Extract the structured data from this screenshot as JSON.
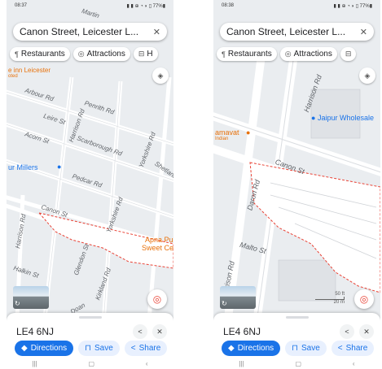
{
  "colors": {
    "accent": "#1a73e8",
    "poi_orange": "#e8710a",
    "poi_blue": "#1a73e8",
    "boundary": "#e94235"
  },
  "left": {
    "status_time": "08:37",
    "status_right": "▮ ▮ ⊕ ◔ ◗ ▯ 77%▮",
    "search_text": "Canon Street, Leicester L...",
    "chips": [
      {
        "icon": "fork-knife-icon",
        "glyph": "🍴",
        "label": "Restaurants"
      },
      {
        "icon": "attractions-icon",
        "glyph": "◎",
        "label": "Attractions"
      },
      {
        "icon": "hotel-icon",
        "glyph": "⊟",
        "label": "H"
      }
    ],
    "pois": {
      "premier": "e inn Leicester",
      "premier_sub": "oted",
      "millers": "ur Millers",
      "apna": "Apna Pu",
      "sweet": "Sweet Ce"
    },
    "streets": [
      "Arbour Rd",
      "Penrith Rd",
      "Leire St",
      "Harrison Rd",
      "Scarborough Rd",
      "Acorn St",
      "Yorkshire Rd",
      "Shetland",
      "Pedcar Rd",
      "Canon St",
      "Harrison Rd",
      "Yorkshire Rd",
      "Halkin St",
      "Glendon St",
      "Kirkland Rd",
      "Doan",
      "Martin"
    ],
    "place_name": "LE4 6NJ",
    "buttons": {
      "directions": "Directions",
      "save": "Save",
      "share": "Share"
    },
    "nav": [
      "|||",
      "▢",
      "‹"
    ]
  },
  "right": {
    "status_time": "08:38",
    "status_right": "▮ ▮ ⊕ ◔ ◗ ▯ 77%▮",
    "search_text": "Canon Street, Leicester L...",
    "chips": [
      {
        "icon": "fork-knife-icon",
        "glyph": "🍴",
        "label": "Restaurants"
      },
      {
        "icon": "attractions-icon",
        "glyph": "◎",
        "label": "Attractions"
      },
      {
        "icon": "hotel-icon",
        "glyph": "⊟",
        "label": ""
      }
    ],
    "pois": {
      "jaipur": "Jaipur Wholesale",
      "amavat": "amavat",
      "amavat_sub": "Indian"
    },
    "streets": [
      "Harrison Rd",
      "Daron Rd",
      "Canon St",
      "Harrison Rd",
      "Malto St"
    ],
    "scale": {
      "ft": "50 ft",
      "m": "20 m"
    },
    "place_name": "LE4 6NJ",
    "buttons": {
      "directions": "Directions",
      "save": "Save",
      "share": "Share"
    },
    "nav": [
      "|||",
      "▢",
      "‹"
    ]
  }
}
